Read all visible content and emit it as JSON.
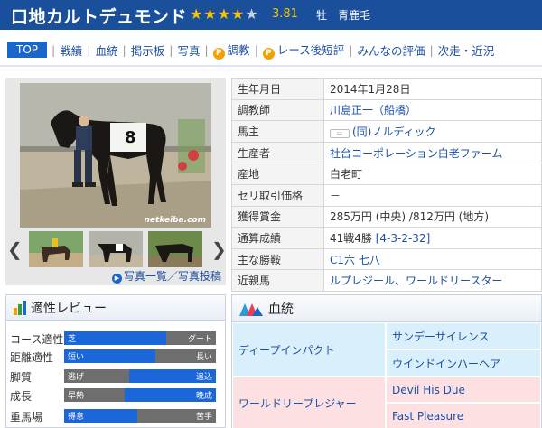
{
  "horse": {
    "name": "口地カルトデュモンド",
    "rating": "3.81",
    "stars": {
      "full": 4,
      "half": 1
    },
    "sex_color": "牡　青鹿毛"
  },
  "nav": [
    {
      "label": "TOP",
      "active": true
    },
    {
      "label": "戦績"
    },
    {
      "label": "血統"
    },
    {
      "label": "掲示板"
    },
    {
      "label": "写真"
    },
    {
      "label": "調教",
      "icon": "P"
    },
    {
      "label": "レース後短評",
      "icon": "P"
    },
    {
      "label": "みんなの評価"
    },
    {
      "label": "次走・近況"
    }
  ],
  "photo": {
    "watermark": "netkeiba.com",
    "links": "写真一覧／写真投稿"
  },
  "profile": [
    {
      "key": "生年月日",
      "value": "2014年1月28日"
    },
    {
      "key": "調教師",
      "value": "川島正一（船橋）",
      "link": true
    },
    {
      "key": "馬主",
      "value": "(同)ノルディック",
      "link": true,
      "icon": "owner-badge-icon"
    },
    {
      "key": "生産者",
      "value": "社台コーポレーション白老ファーム",
      "link": true
    },
    {
      "key": "産地",
      "value": "白老町"
    },
    {
      "key": "セリ取引価格",
      "value": "－"
    },
    {
      "key": "獲得賞金",
      "value": "285万円 (中央) /812万円 (地方)"
    },
    {
      "key": "通算成績",
      "value": "41戦4勝 ",
      "extra": "[4-3-2-32]"
    },
    {
      "key": "主な勝鞍",
      "value": "C1六 七八",
      "link": true
    },
    {
      "key": "近親馬",
      "value": "ルプレジール、ワールドリースター",
      "link": true
    }
  ],
  "review": {
    "title": "適性レビュー",
    "rows": [
      {
        "label": "コース適性",
        "left": "芝",
        "right": "ダート",
        "fill_start": 0.0,
        "fill_end": 0.67
      },
      {
        "label": "距離適性",
        "left": "短い",
        "right": "長い",
        "fill_start": 0.0,
        "fill_end": 0.6
      },
      {
        "label": "脚質",
        "left": "逃げ",
        "right": "追込",
        "fill_start": 0.43,
        "fill_end": 1.0
      },
      {
        "label": "成長",
        "left": "早熟",
        "right": "晩成",
        "fill_start": 0.4,
        "fill_end": 1.0
      },
      {
        "label": "重馬場",
        "left": "得意",
        "right": "苦手",
        "fill_start": 0.0,
        "fill_end": 0.48
      }
    ]
  },
  "pedigree": {
    "title": "血統",
    "sire": "ディープインパクト",
    "sire_sire": "サンデーサイレンス",
    "sire_dam": "ウインドインハーヘア",
    "dam": "ワールドリープレジャー",
    "dam_sire": "Devil His Due",
    "dam_dam": "Fast Pleasure"
  },
  "colors": {
    "header_bg": "#1a4f9c",
    "accent_blue": "#1b66d8",
    "star": "#f6c500",
    "sire_bg": "#d9f0fc",
    "dam_bg": "#fde0e2"
  }
}
